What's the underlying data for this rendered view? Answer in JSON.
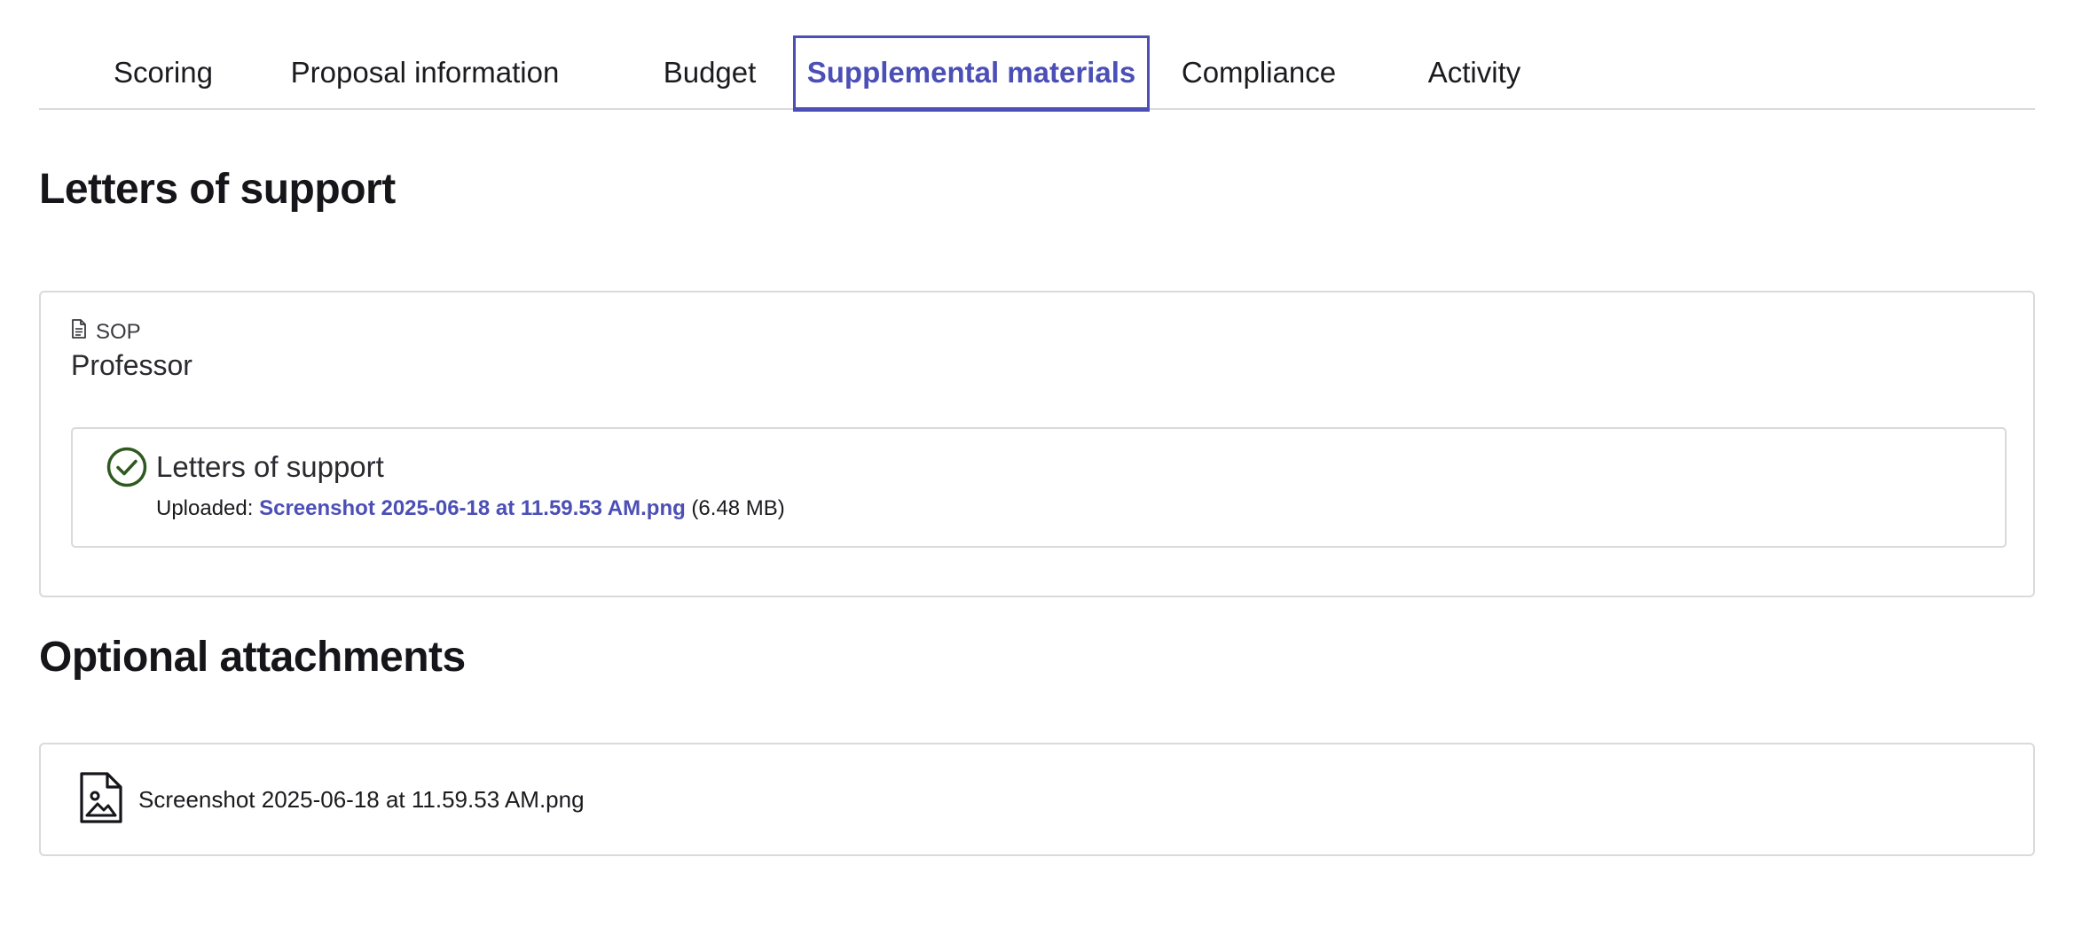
{
  "tabs": [
    {
      "label": "Scoring",
      "active": false
    },
    {
      "label": "Proposal information",
      "active": false
    },
    {
      "label": "Budget",
      "active": false
    },
    {
      "label": "Supplemental materials",
      "active": true
    },
    {
      "label": "Compliance",
      "active": false
    },
    {
      "label": "Activity",
      "active": false
    }
  ],
  "letters": {
    "heading": "Letters of support",
    "document_type": "SOP",
    "document_type_icon": "document-icon",
    "recipient": "Professor",
    "item": {
      "status_icon": "check-circle-icon",
      "title": "Letters of support",
      "uploaded_prefix": "Uploaded: ",
      "file_name": "Screenshot 2025-06-18 at 11.59.53 AM.png",
      "file_size": " (6.48 MB)"
    }
  },
  "optional": {
    "heading": "Optional attachments",
    "attachments": [
      {
        "icon": "image-file-icon",
        "name": "Screenshot 2025-06-18 at 11.59.53 AM.png"
      }
    ]
  },
  "colors": {
    "accent": "#4b4fb6",
    "success": "#2e5a1f",
    "border": "#d9d9de"
  }
}
